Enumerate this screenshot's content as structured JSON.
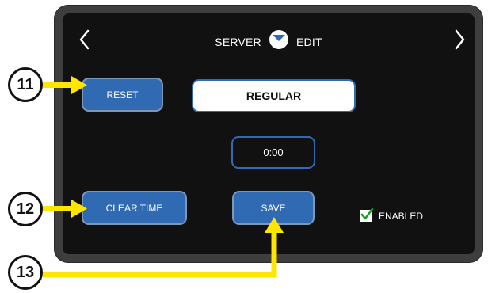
{
  "header": {
    "title_left": "SERVER",
    "title_right": "EDIT",
    "left_arrow_icon": "chevron-left-icon",
    "right_arrow_icon": "chevron-right-icon",
    "logo_icon": "brand-logo-icon"
  },
  "controls": {
    "reset_label": "RESET",
    "mode_value": "REGULAR",
    "time_value": "0:00",
    "clear_time_label": "CLEAR TIME",
    "save_label": "SAVE",
    "enabled_label": "ENABLED",
    "enabled_checked": true
  },
  "callouts": {
    "reset": "11",
    "clear_time": "12",
    "save": "13"
  },
  "colors": {
    "screen_bg": "#111111",
    "button_blue": "#2f6ab3",
    "callout_arrow": "#ffe600"
  }
}
